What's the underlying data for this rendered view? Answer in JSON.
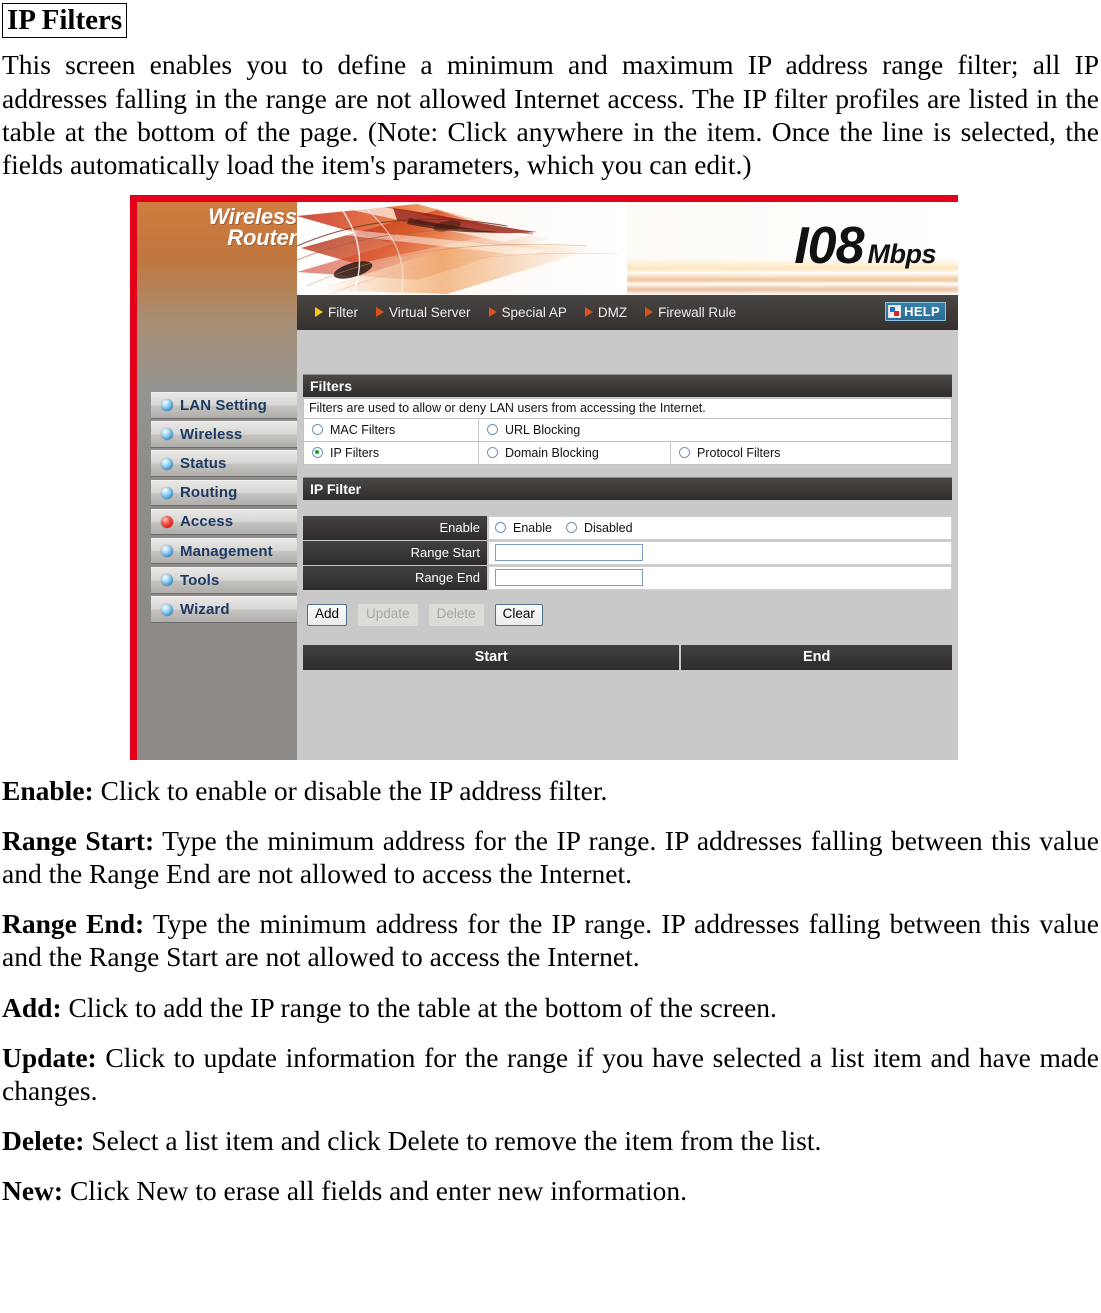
{
  "document": {
    "title": "IP Filters",
    "intro": "This screen enables you to define a minimum and maximum IP address range filter; all IP addresses falling in the range are not allowed Internet access.  The IP filter profiles are listed in the table at the bottom of the page. (Note: Click anywhere in the item. Once the line is selected, the fields automatically load the item's parameters, which you can edit.)",
    "definitions": [
      {
        "term": "Enable:",
        "text": " Click to enable or disable the IP address filter."
      },
      {
        "term": "Range Start:",
        "text": " Type the minimum address for the IP range. IP addresses falling between this value and the Range End are not allowed to access the Internet."
      },
      {
        "term": "Range End:",
        "text": " Type the minimum address for the IP range. IP addresses falling between this value and the Range Start are not allowed to access the Internet."
      },
      {
        "term": "Add:",
        "text": " Click to add the IP range to the table at the bottom of the screen."
      },
      {
        "term": "Update:",
        "text": " Click to update information for the range if you have selected a list item and have made changes."
      },
      {
        "term": "Delete:",
        "text": " Select a list item and click Delete to remove the item from the list."
      },
      {
        "term": "New:",
        "text": " Click New to erase all fields and enter new information."
      }
    ]
  },
  "screenshot": {
    "brand": {
      "line1": "Wireless",
      "line2": "Router"
    },
    "banner": {
      "speed": "I08",
      "unit": "Mbps"
    },
    "nav": {
      "items": [
        {
          "label": "Filter",
          "active": true
        },
        {
          "label": "Virtual Server",
          "active": false
        },
        {
          "label": "Special AP",
          "active": false
        },
        {
          "label": "DMZ",
          "active": false
        },
        {
          "label": "Firewall Rule",
          "active": false
        }
      ],
      "help_label": "HELP"
    },
    "sidebar": {
      "items": [
        {
          "label": "LAN Setting",
          "active": false
        },
        {
          "label": "Wireless",
          "active": false
        },
        {
          "label": "Status",
          "active": false
        },
        {
          "label": "Routing",
          "active": false
        },
        {
          "label": "Access",
          "active": true
        },
        {
          "label": "Management",
          "active": false
        },
        {
          "label": "Tools",
          "active": false
        },
        {
          "label": "Wizard",
          "active": false
        }
      ]
    },
    "filters_section": {
      "heading": "Filters",
      "description": "Filters are used to allow or deny LAN users from accessing the Internet.",
      "options": [
        {
          "label": "MAC Filters",
          "selected": false
        },
        {
          "label": "URL Blocking",
          "selected": false
        },
        {
          "label": "IP Filters",
          "selected": true
        },
        {
          "label": "Domain Blocking",
          "selected": false
        },
        {
          "label": "Protocol Filters",
          "selected": false
        }
      ]
    },
    "ip_filter_section": {
      "heading": "IP Filter",
      "enable_label": "Enable",
      "enable_option": "Enable",
      "disabled_option": "Disabled",
      "enable_selected": false,
      "disabled_selected": false,
      "range_start_label": "Range Start",
      "range_start_value": "",
      "range_end_label": "Range End",
      "range_end_value": "",
      "buttons": [
        {
          "label": "Add",
          "enabled": true
        },
        {
          "label": "Update",
          "enabled": false
        },
        {
          "label": "Delete",
          "enabled": false
        },
        {
          "label": "Clear",
          "enabled": true
        }
      ],
      "table": {
        "columns": [
          "Start",
          "End"
        ],
        "rows": []
      }
    },
    "colors": {
      "accent_red": "#e4001b",
      "dark_bar": "#373433",
      "panel_gray": "#c9c9c9",
      "menu_text": "#1c3a63",
      "radio_selected": "#19a319",
      "help_blue": "#2a6b94"
    }
  }
}
